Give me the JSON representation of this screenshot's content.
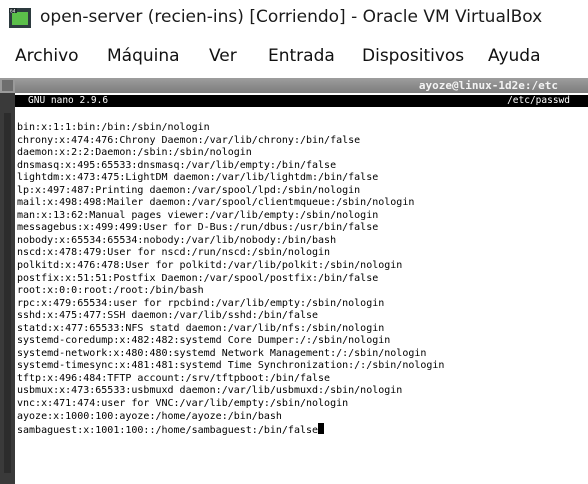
{
  "window": {
    "title": "open-server (recien-ins) [Corriendo] - Oracle VM VirtualBox",
    "icon": "virtualbox-icon"
  },
  "menu": [
    {
      "label": "Archivo"
    },
    {
      "label": "Máquina"
    },
    {
      "label": "Ver"
    },
    {
      "label": "Entrada"
    },
    {
      "label": "Dispositivos"
    },
    {
      "label": "Ayuda"
    }
  ],
  "guest": {
    "title": "ayoze@linux-1d2e:/etc"
  },
  "nano": {
    "version": "GNU nano 2.9.6",
    "filename": "/etc/passwd",
    "lines": [
      "bin:x:1:1:bin:/bin:/sbin/nologin",
      "chrony:x:474:476:Chrony Daemon:/var/lib/chrony:/bin/false",
      "daemon:x:2:2:Daemon:/sbin:/sbin/nologin",
      "dnsmasq:x:495:65533:dnsmasq:/var/lib/empty:/bin/false",
      "lightdm:x:473:475:LightDM daemon:/var/lib/lightdm:/bin/false",
      "lp:x:497:487:Printing daemon:/var/spool/lpd:/sbin/nologin",
      "mail:x:498:498:Mailer daemon:/var/spool/clientmqueue:/sbin/nologin",
      "man:x:13:62:Manual pages viewer:/var/lib/empty:/sbin/nologin",
      "messagebus:x:499:499:User for D-Bus:/run/dbus:/usr/bin/false",
      "nobody:x:65534:65534:nobody:/var/lib/nobody:/bin/bash",
      "nscd:x:478:479:User for nscd:/run/nscd:/sbin/nologin",
      "polkitd:x:476:478:User for polkitd:/var/lib/polkit:/sbin/nologin",
      "postfix:x:51:51:Postfix Daemon:/var/spool/postfix:/bin/false",
      "root:x:0:0:root:/root:/bin/bash",
      "rpc:x:479:65534:user for rpcbind:/var/lib/empty:/sbin/nologin",
      "sshd:x:475:477:SSH daemon:/var/lib/sshd:/bin/false",
      "statd:x:477:65533:NFS statd daemon:/var/lib/nfs:/sbin/nologin",
      "systemd-coredump:x:482:482:systemd Core Dumper:/:/sbin/nologin",
      "systemd-network:x:480:480:systemd Network Management:/:/sbin/nologin",
      "systemd-timesync:x:481:481:systemd Time Synchronization:/:/sbin/nologin",
      "tftp:x:496:484:TFTP account:/srv/tftpboot:/bin/false",
      "usbmux:x:473:65533:usbmuxd daemon:/var/lib/usbmuxd:/sbin/nologin",
      "vnc:x:471:474:user for VNC:/var/lib/empty:/sbin/nologin",
      "ayoze:x:1000:100:ayoze:/home/ayoze:/bin/bash",
      "sambaguest:x:1001:100::/home/sambaguest:/bin/false"
    ]
  }
}
